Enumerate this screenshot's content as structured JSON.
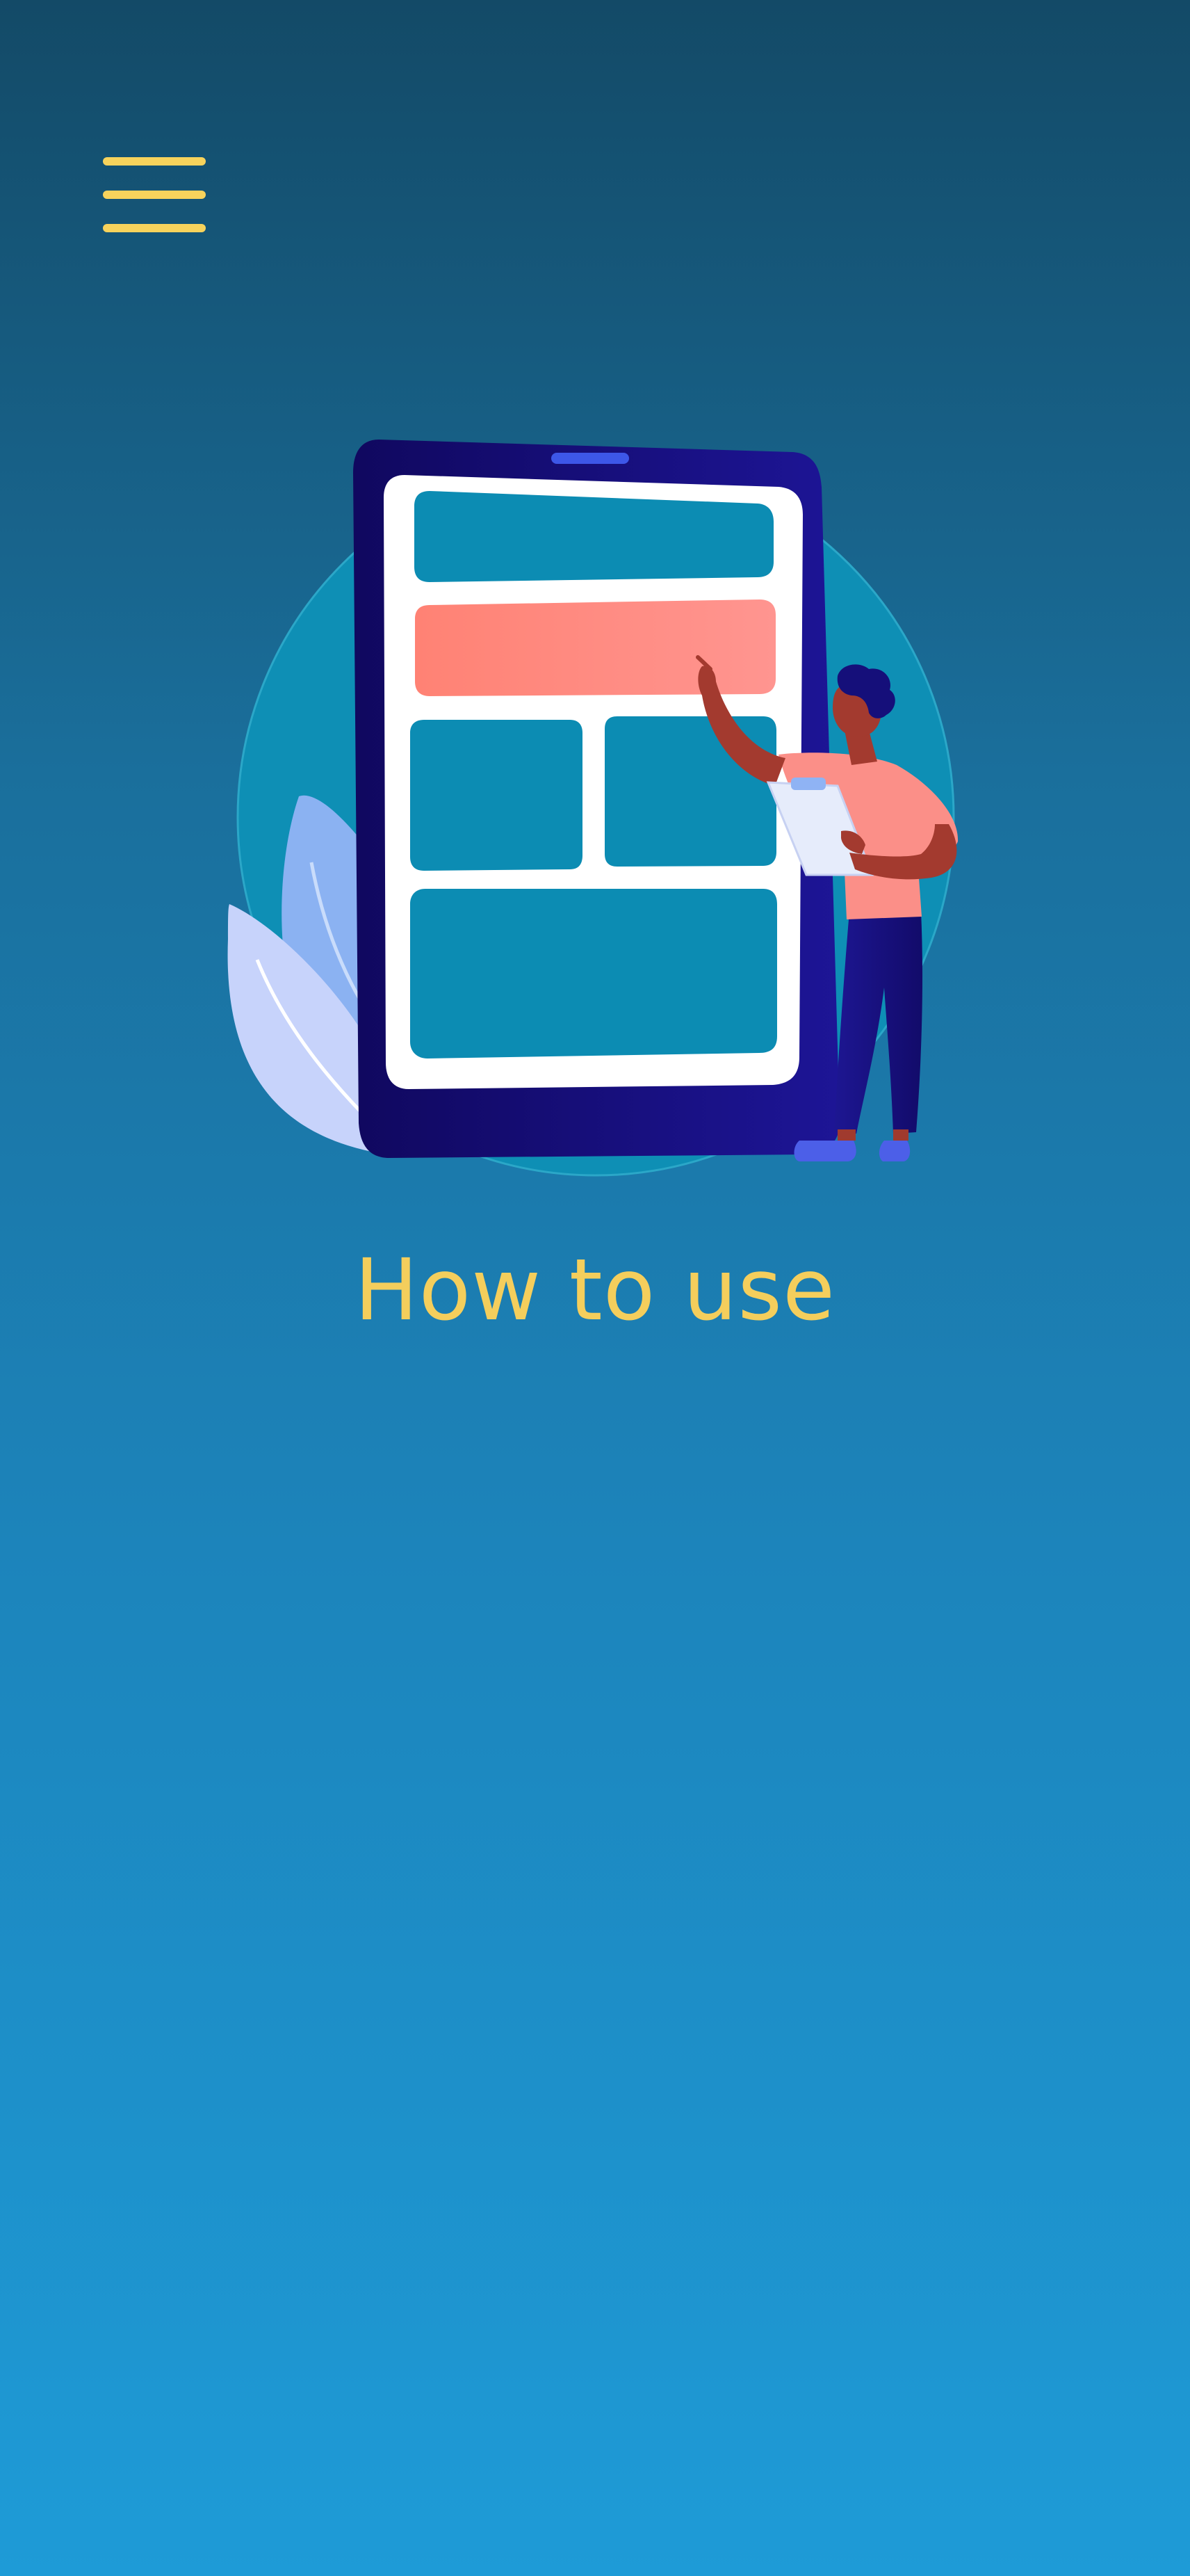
{
  "header": {
    "menu_icon": "hamburger-menu-icon"
  },
  "hero": {
    "illustration": "person-pointing-at-phone-illustration"
  },
  "page": {
    "title": "How to use"
  },
  "colors": {
    "accent": "#f7d35c",
    "background_top": "#134a67",
    "background_bottom": "#1e9bd7",
    "phone_frame": "#150f7a",
    "card_teal": "#0c8cb3",
    "card_coral": "#ff8a7c"
  }
}
